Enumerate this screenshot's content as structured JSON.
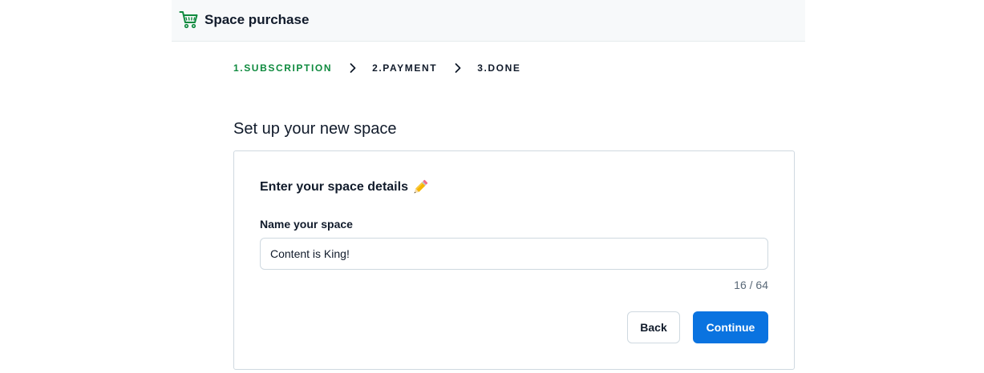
{
  "header": {
    "title": "Space purchase",
    "icon": "shopping-cart-icon",
    "icon_color": "#0e8a3e"
  },
  "steps": [
    {
      "label": "1.SUBSCRIPTION",
      "active": true
    },
    {
      "label": "2.PAYMENT",
      "active": false
    },
    {
      "label": "3.DONE",
      "active": false
    }
  ],
  "page": {
    "heading": "Set up your new space"
  },
  "card": {
    "title": "Enter your space details",
    "title_icon": "pencil-icon",
    "field_label": "Name your space",
    "input_value": "Content is King!",
    "char_count": "16 / 64",
    "back_label": "Back",
    "continue_label": "Continue"
  },
  "colors": {
    "accent": "#0a73e0",
    "active_step": "#0e8a3e",
    "text": "#111b2b"
  }
}
